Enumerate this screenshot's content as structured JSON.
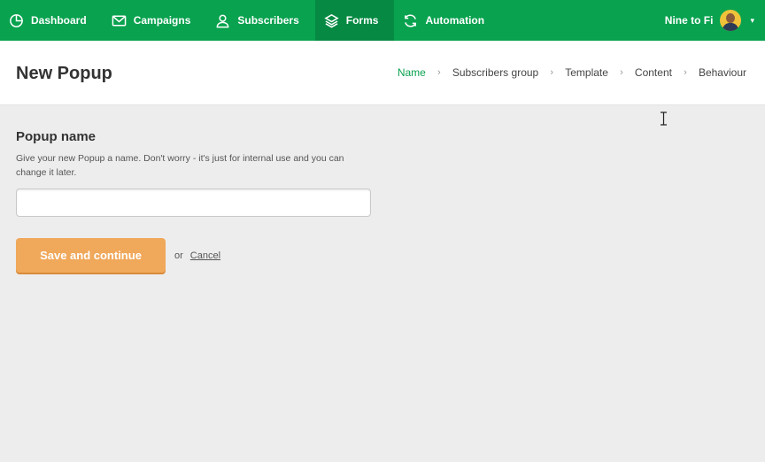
{
  "topnav": {
    "items": [
      {
        "label": "Dashboard",
        "icon": "dashboard-icon"
      },
      {
        "label": "Campaigns",
        "icon": "envelope-icon"
      },
      {
        "label": "Subscribers",
        "icon": "user-icon"
      },
      {
        "label": "Forms",
        "icon": "layers-icon",
        "active": true
      },
      {
        "label": "Automation",
        "icon": "refresh-icon"
      }
    ],
    "account_name": "Nine to Fi",
    "caret": "▾"
  },
  "header": {
    "title": "New Popup",
    "breadcrumb": [
      "Name",
      "Subscribers group",
      "Template",
      "Content",
      "Behaviour"
    ],
    "breadcrumb_separator": "›"
  },
  "form": {
    "section_title": "Popup name",
    "help_text": "Give your new Popup a name. Don't worry - it's just for internal use and you can change it later.",
    "input_value": "",
    "input_placeholder": "",
    "save_label": "Save and continue",
    "or_label": "or",
    "cancel_label": "Cancel"
  },
  "colors": {
    "nav_green": "#09a24f",
    "nav_active": "#068a43",
    "accent_orange": "#f0a85a",
    "page_bg": "#ededed"
  }
}
